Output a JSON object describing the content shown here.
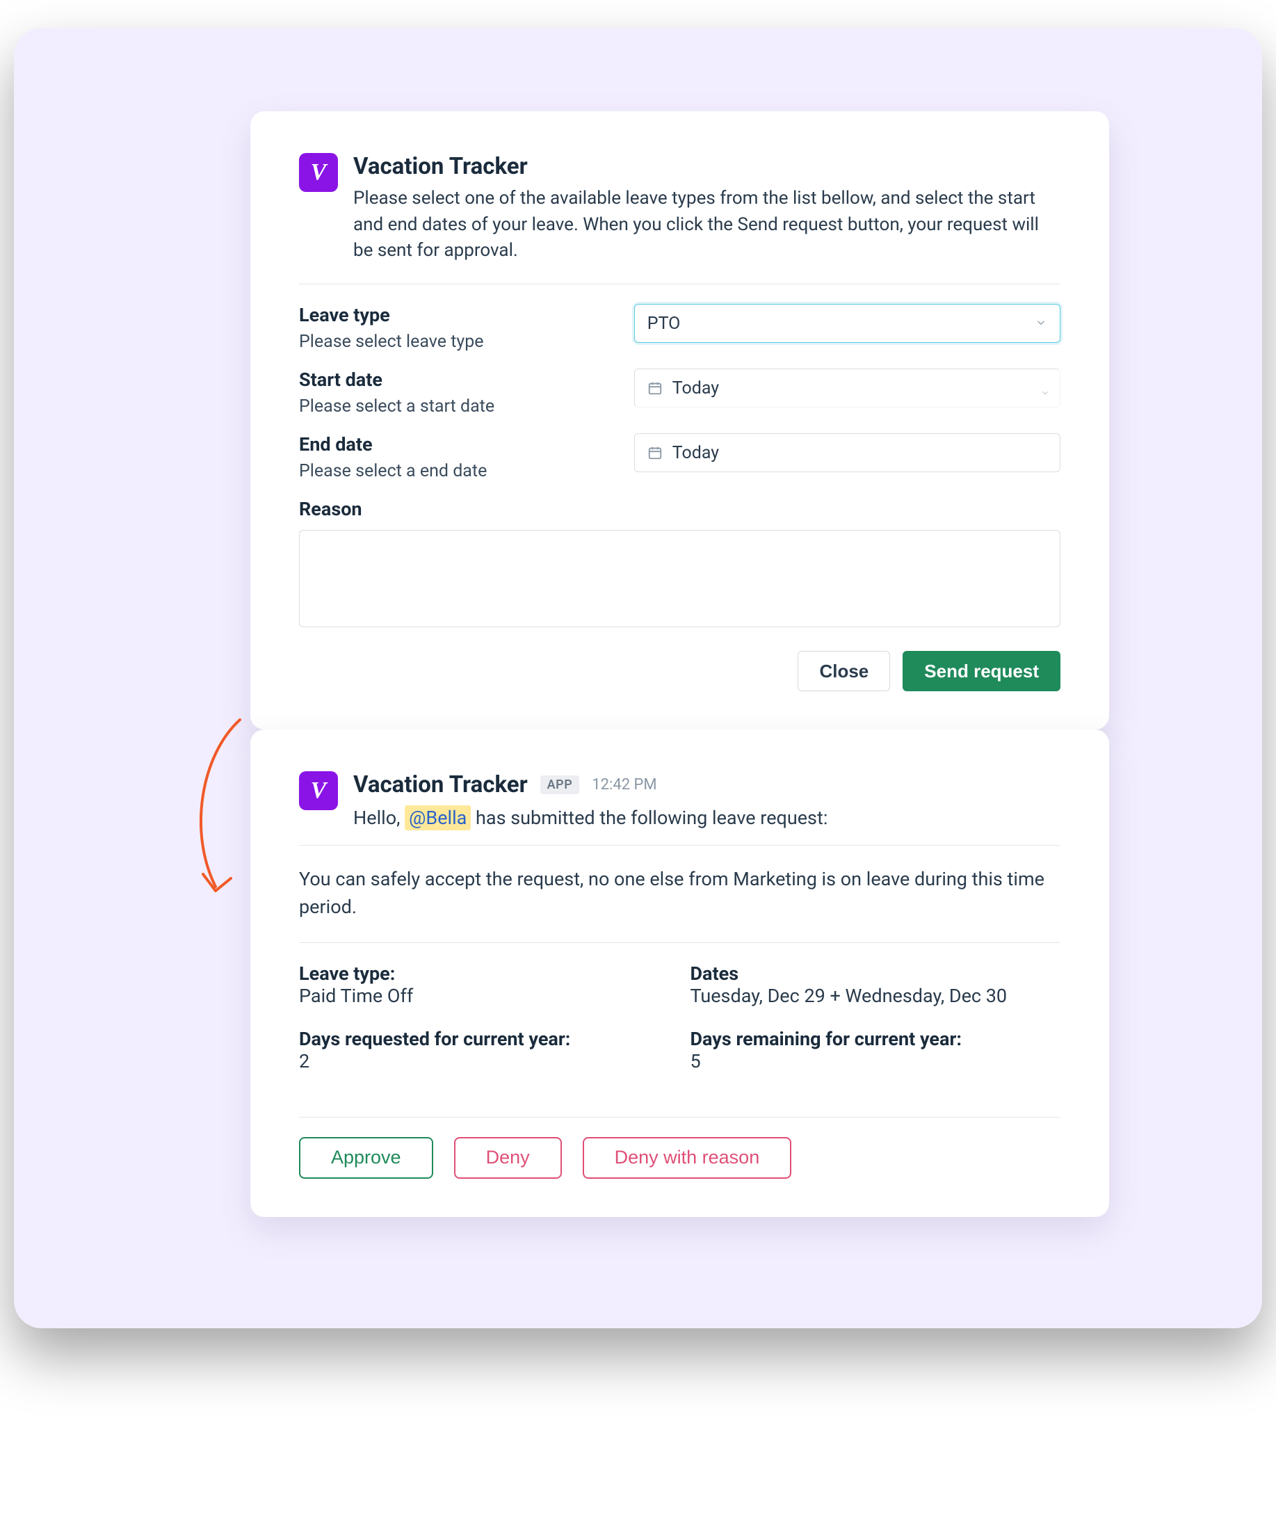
{
  "app_name": "Vacation Tracker",
  "request_form": {
    "intro": "Please select one of the available leave types from the list bellow, and select the start and end dates of your leave. When you click the Send request button, your request will be sent for approval.",
    "leave_type": {
      "label": "Leave type",
      "hint": "Please select leave type",
      "value": "PTO"
    },
    "start_date": {
      "label": "Start date",
      "hint": "Please select a start date",
      "value": "Today"
    },
    "end_date": {
      "label": "End date",
      "hint": "Please select a end date",
      "value": "Today"
    },
    "reason": {
      "label": "Reason",
      "value": ""
    },
    "buttons": {
      "close": "Close",
      "send": "Send request"
    }
  },
  "notification": {
    "badge": "APP",
    "time": "12:42 PM",
    "greeting_prefix": "Hello, ",
    "mention": "@Bella",
    "greeting_suffix": " has submitted the following leave request:",
    "safe_note": "You can safely accept the request, no one else from Marketing is on leave during this time period.",
    "fields": {
      "leave_type_label": "Leave type:",
      "leave_type_value": "Paid Time Off",
      "dates_label": "Dates",
      "dates_value": "Tuesday, Dec 29 + Wednesday, Dec 30",
      "days_requested_label": "Days requested for current year:",
      "days_requested_value": "2",
      "days_remaining_label": "Days remaining for current year:",
      "days_remaining_value": "5"
    },
    "buttons": {
      "approve": "Approve",
      "deny": "Deny",
      "deny_with_reason": "Deny with reason"
    }
  }
}
